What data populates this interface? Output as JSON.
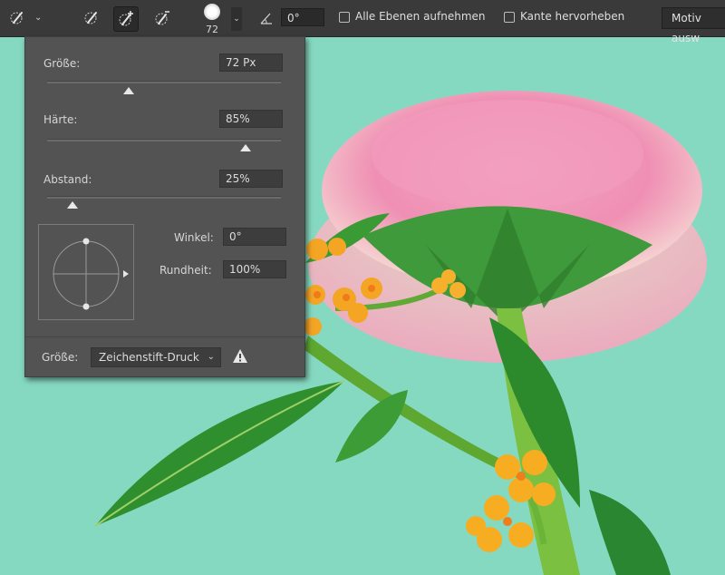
{
  "toolbar": {
    "brush_size_value": "72",
    "angle_value": "0°",
    "sample_all_layers_label": "Alle Ebenen aufnehmen",
    "enhance_edge_label": "Kante hervorheben",
    "select_subject_label": "Motiv ausw"
  },
  "brush_panel": {
    "size_label": "Größe:",
    "size_value": "72 Px",
    "size_fraction": 0.35,
    "hardness_label": "Härte:",
    "hardness_value": "85%",
    "hardness_fraction": 0.85,
    "spacing_label": "Abstand:",
    "spacing_value": "25%",
    "spacing_fraction": 0.11,
    "angle_label": "Winkel:",
    "angle_value": "0°",
    "roundness_label": "Rundheit:",
    "roundness_value": "100%",
    "control_label": "Größe:",
    "control_value": "Zeichenstift-Druck"
  },
  "colors": {
    "canvas_bg": "#86d9c1",
    "panel_bg": "#535353",
    "toolbar_bg": "#3a3a3a"
  }
}
